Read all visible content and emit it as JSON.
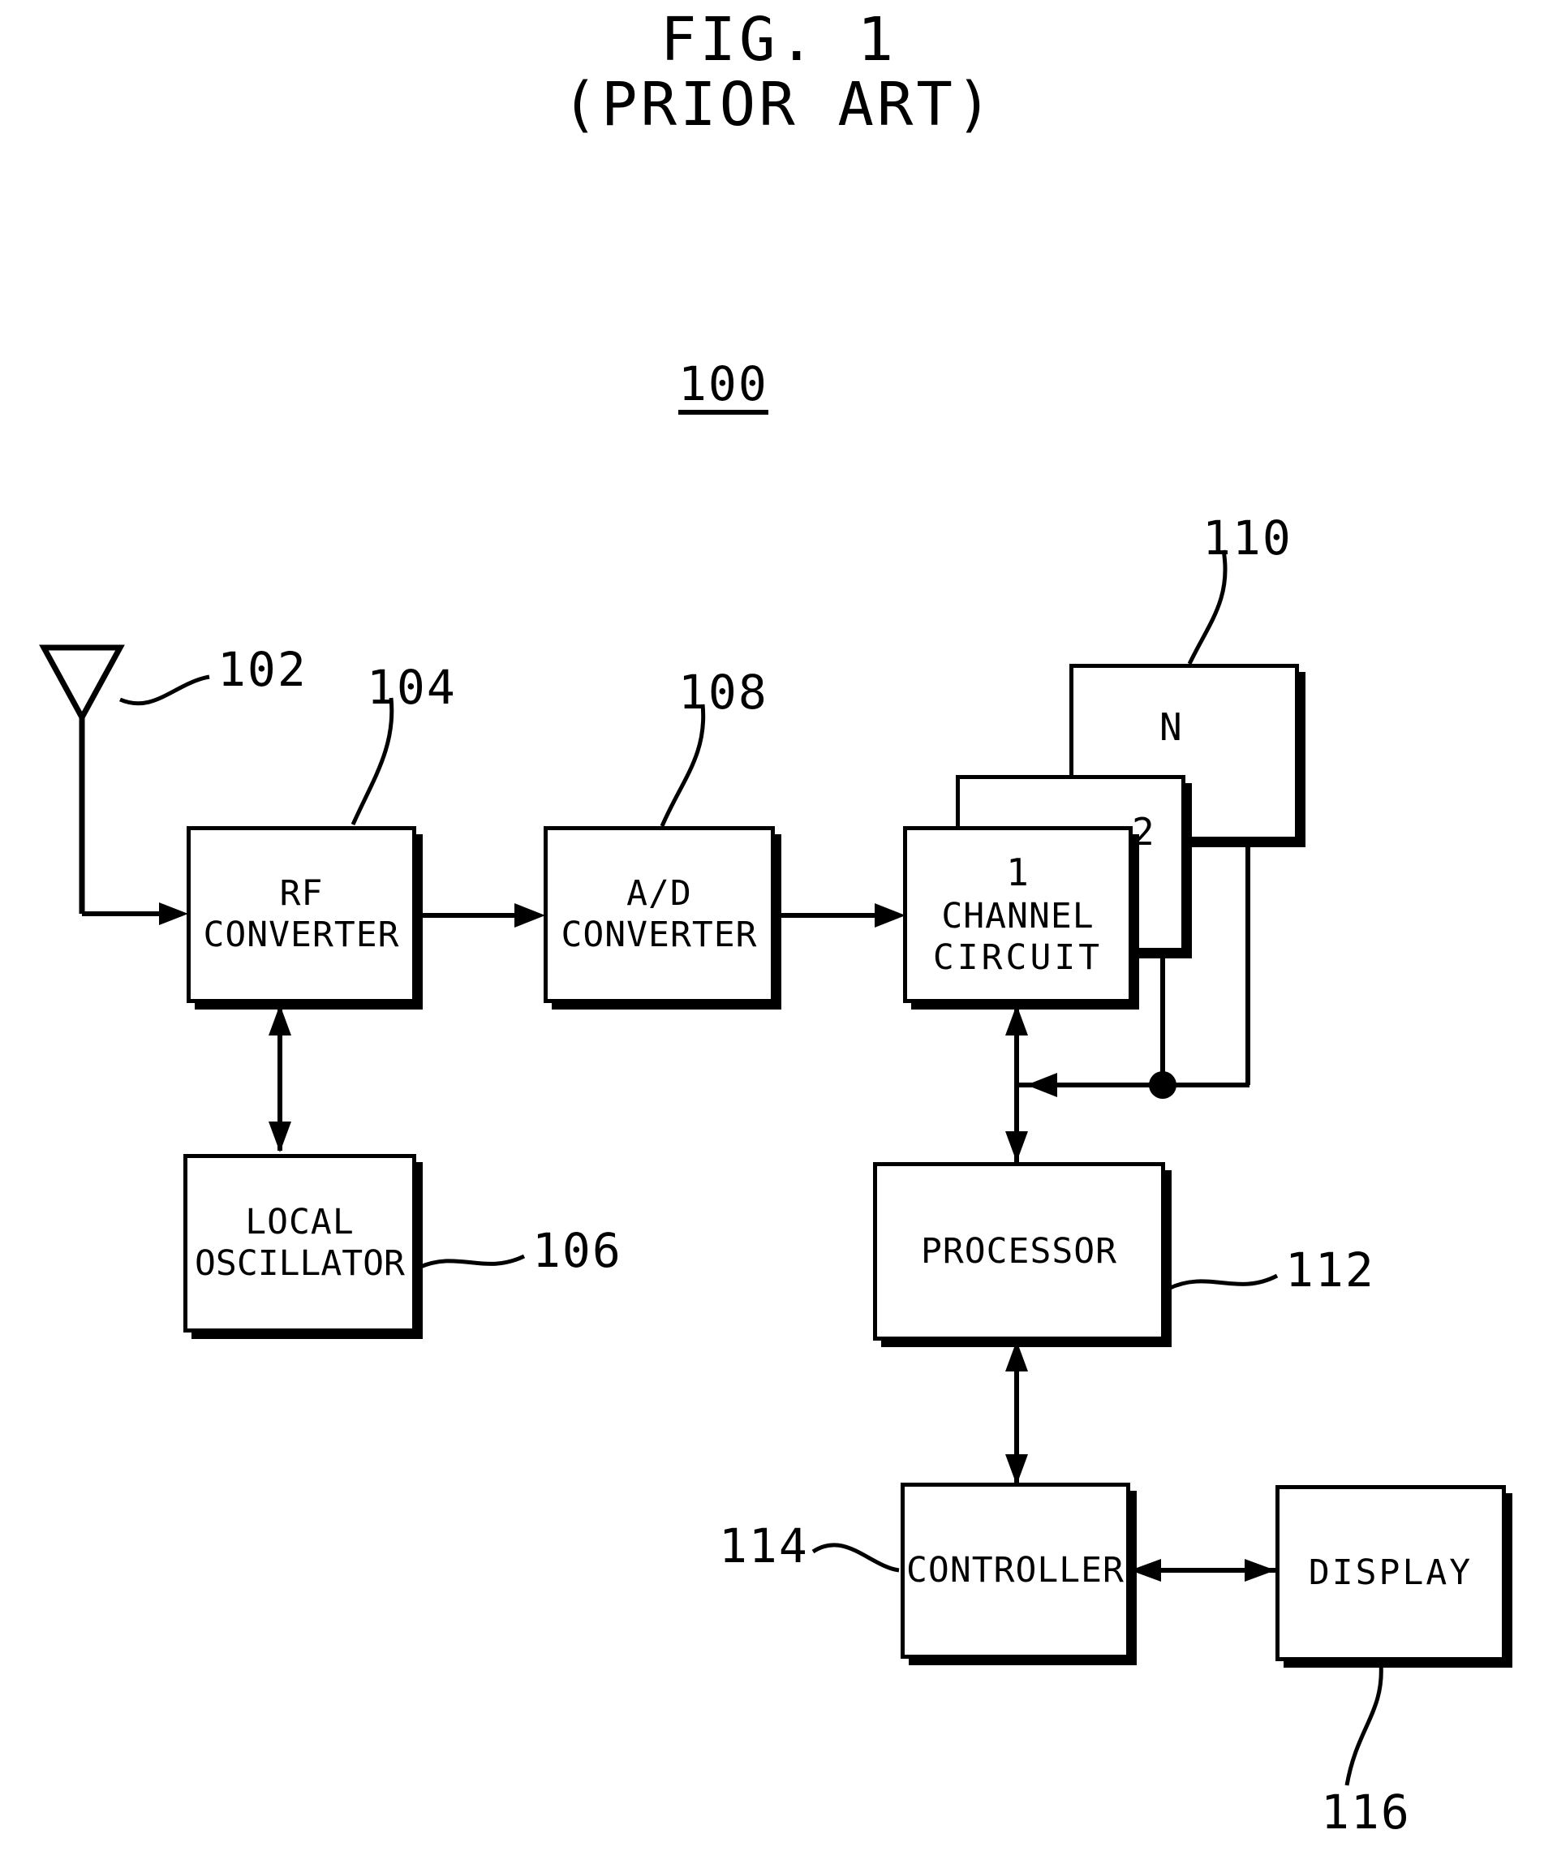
{
  "figure": {
    "title_line1": "FIG. 1",
    "title_line2": "(PRIOR ART)",
    "system_ref": "100"
  },
  "blocks": {
    "rf_converter": {
      "line1": "RF",
      "line2": "CONVERTER",
      "ref": "104"
    },
    "ad_converter": {
      "line1": "A/D",
      "line2": "CONVERTER",
      "ref": "108"
    },
    "channel_circuit": {
      "index": "1",
      "line1": "CHANNEL",
      "line2": "CIRCUIT",
      "ref": "110"
    },
    "channel_circuit_2": {
      "index": "2"
    },
    "channel_circuit_n": {
      "index": "N"
    },
    "local_oscillator": {
      "line1": "LOCAL",
      "line2": "OSCILLATOR",
      "ref": "106"
    },
    "processor": {
      "line1": "PROCESSOR",
      "ref": "112"
    },
    "controller": {
      "line1": "CONTROLLER",
      "ref": "114"
    },
    "display": {
      "line1": "DISPLAY",
      "ref": "116"
    },
    "antenna": {
      "ref": "102"
    }
  },
  "colors": {
    "ink": "#000000",
    "paper": "#ffffff"
  }
}
